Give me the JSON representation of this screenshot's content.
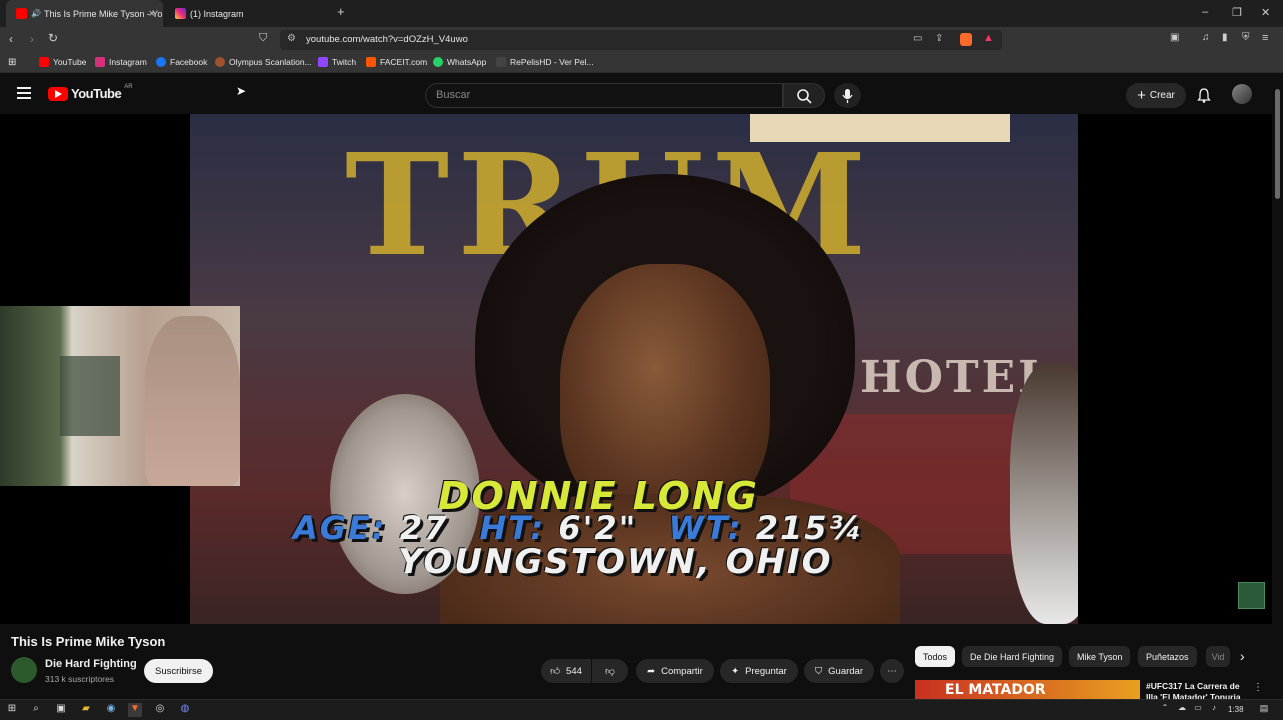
{
  "browser": {
    "tabs": [
      {
        "label": "This Is Prime Mike Tyson - Yo",
        "active": true
      },
      {
        "label": "(1) Instagram",
        "active": false
      }
    ],
    "new_tab": "+",
    "url": "youtube.com/watch?v=dOZzH_V4uwo",
    "bookmarks": [
      "YouTube",
      "Instagram",
      "Facebook",
      "Olympus Scanlation...",
      "Twitch",
      "FACEIT.com",
      "WhatsApp",
      "RePelisHD - Ver Pel..."
    ]
  },
  "youtube": {
    "logo_text": "YouTube",
    "region": "AR",
    "search_placeholder": "Buscar",
    "create_label": "Crear"
  },
  "video": {
    "caption_name": "DONNIE LONG",
    "caption_age_label": "AGE:",
    "caption_age": "27",
    "caption_ht_label": "HT:",
    "caption_ht": "6'2\"",
    "caption_wt_label": "WT:",
    "caption_wt": "215¾",
    "caption_hometown": "YOUNGSTOWN, OHIO",
    "background_sign": "TRUM",
    "background_hotel": "HOTEL"
  },
  "watch": {
    "title": "This Is Prime Mike Tyson",
    "channel_name": "Die Hard Fighting",
    "subscribers": "313 k suscriptores",
    "subscribe_label": "Suscribirse",
    "like_count": "544",
    "share_label": "Compartir",
    "ask_label": "Preguntar",
    "save_label": "Guardar"
  },
  "related": {
    "chips": [
      "Todos",
      "De Die Hard Fighting",
      "Mike Tyson",
      "Puñetazos",
      "Vid"
    ],
    "first_title": "#UFC317 La Carrera de Illa 'El Matador' Topuria",
    "first_thumb_text": "EL MATADOR"
  },
  "taskbar": {
    "time": "1:38"
  },
  "colors": {
    "youtube_red": "#ff0000",
    "caption_yellow": "#d8e838",
    "caption_blue": "#3a7ad8",
    "caption_white": "#f0f0f0"
  }
}
